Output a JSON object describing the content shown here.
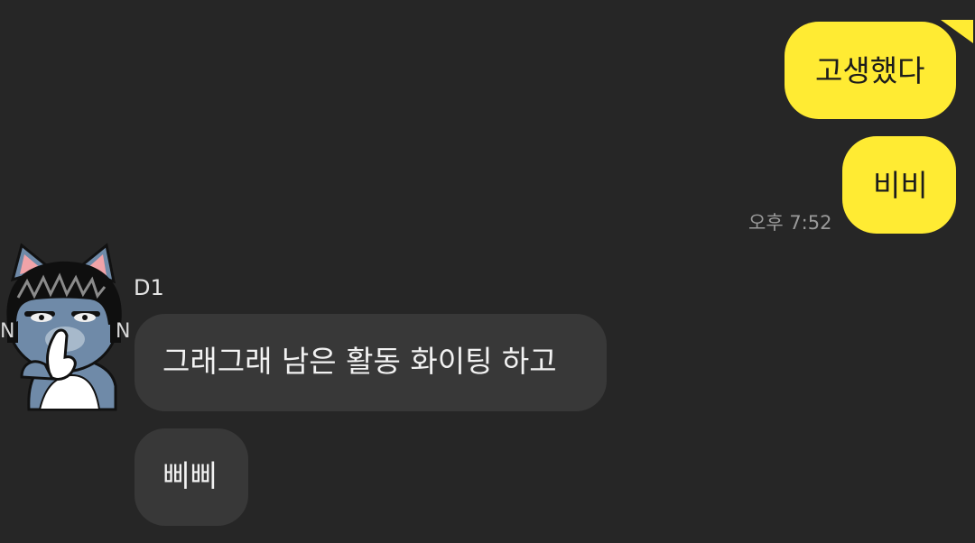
{
  "conversation": {
    "outgoing": [
      {
        "text": "고생했다"
      },
      {
        "text": "비비"
      }
    ],
    "outgoing_time": "오후 7:52",
    "incoming": {
      "sender": "D1",
      "avatar_icon": "neo-cat-character-avatar",
      "messages": [
        {
          "text": "그래그래 남은 활동 화이팅 하고"
        },
        {
          "text": "삐삐"
        }
      ]
    }
  },
  "colors": {
    "background": "#262626",
    "outgoing_bubble": "#ffeb33",
    "incoming_bubble": "#383838",
    "timestamp": "#9a9a9a"
  }
}
